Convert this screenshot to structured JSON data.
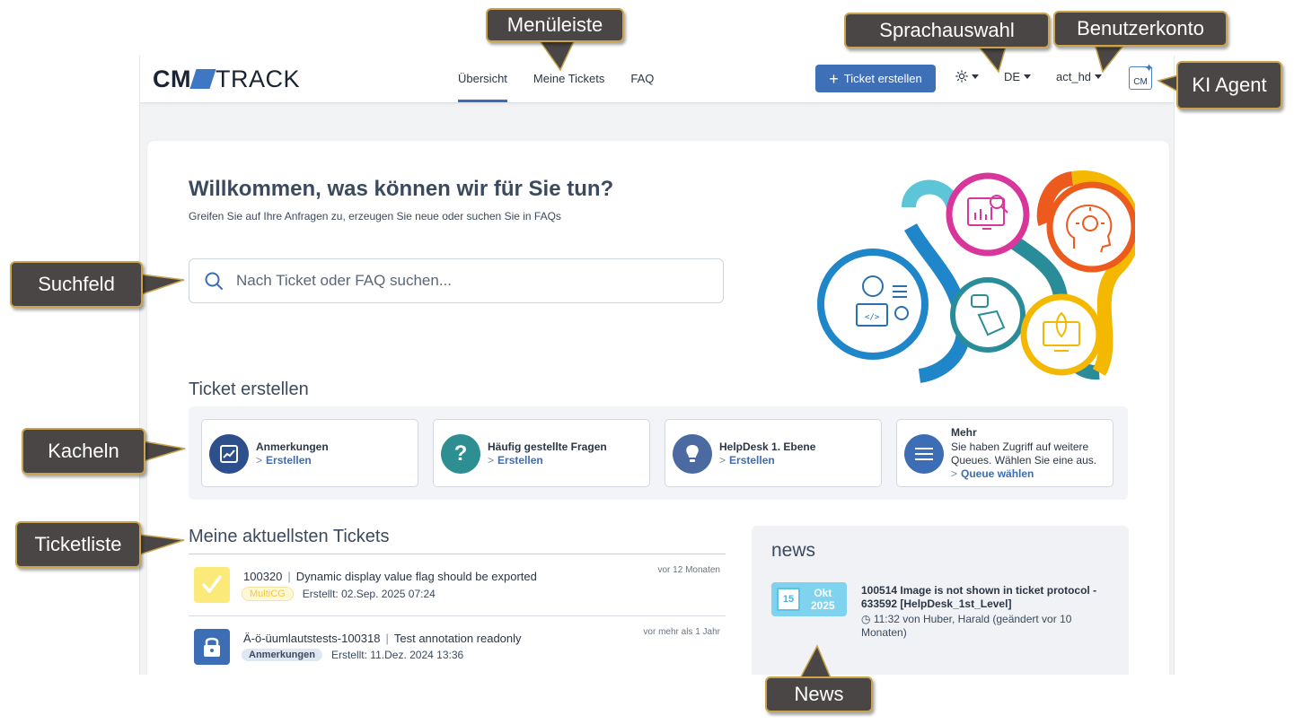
{
  "app": {
    "logo_cm": "CM",
    "logo_track": "TRACK",
    "nav": [
      {
        "label": "Übersicht",
        "active": true
      },
      {
        "label": "Meine Tickets",
        "active": false
      },
      {
        "label": "FAQ",
        "active": false
      }
    ],
    "create_button": "Ticket erstellen",
    "theme_icon": "sun-icon",
    "language": "DE",
    "account": "act_hd",
    "ki_icon_text": "CM",
    "accent": "#3f6fb6"
  },
  "hero": {
    "title": "Willkommen, was können wir für Sie tun?",
    "subtitle": "Greifen Sie auf Ihre Anfragen zu, erzeugen Sie neue oder suchen Sie in FAQs",
    "search_placeholder": "Nach Ticket oder FAQ suchen..."
  },
  "create_section": {
    "heading": "Ticket erstellen",
    "tiles": [
      {
        "title": "Anmerkungen",
        "link": "Erstellen",
        "icon": "chart-icon",
        "color": "#2d4f8c"
      },
      {
        "title": "Häufig gestellte Fragen",
        "link": "Erstellen",
        "icon": "question-icon",
        "color": "#2e8f92"
      },
      {
        "title": "HelpDesk 1. Ebene",
        "link": "Erstellen",
        "icon": "lightbulb-icon",
        "color": "#4a6aa1"
      },
      {
        "title": "Mehr",
        "description": "Sie haben Zugriff auf weitere Queues. Wählen Sie eine aus.",
        "link": "Queue wählen",
        "icon": "menu-icon",
        "color": "#3d6db5"
      }
    ]
  },
  "tickets_section": {
    "heading": "Meine aktuellsten Tickets",
    "items": [
      {
        "id": "100320",
        "title": "Dynamic display value flag should be exported",
        "badge": "MultiCG",
        "created": "Erstellt: 02.Sep. 2025 07:24",
        "ago": "vor 12 Monaten",
        "icon": "check-icon"
      },
      {
        "id": "Ä-ö-üumlautstests-100318",
        "title": "Test annotation readonly",
        "badge": "Anmerkungen",
        "created": "Erstellt: 11.Dez. 2024 13:36",
        "ago": "vor mehr als 1 Jahr",
        "icon": "lock-icon"
      }
    ]
  },
  "news": {
    "heading": "news",
    "day": "15",
    "month": "Okt",
    "year": "2025",
    "title": "100514 Image is not shown in ticket protocol - 633592 [HelpDesk_1st_Level]",
    "meta": "11:32 von Huber, Harald (geändert vor 10 Monaten)"
  },
  "callouts": {
    "menu": "Menüleiste",
    "language": "Sprachauswahl",
    "account": "Benutzerkonto",
    "ki": "KI Agent",
    "search": "Suchfeld",
    "tiles": "Kacheln",
    "tickets": "Ticketliste",
    "news": "News"
  }
}
